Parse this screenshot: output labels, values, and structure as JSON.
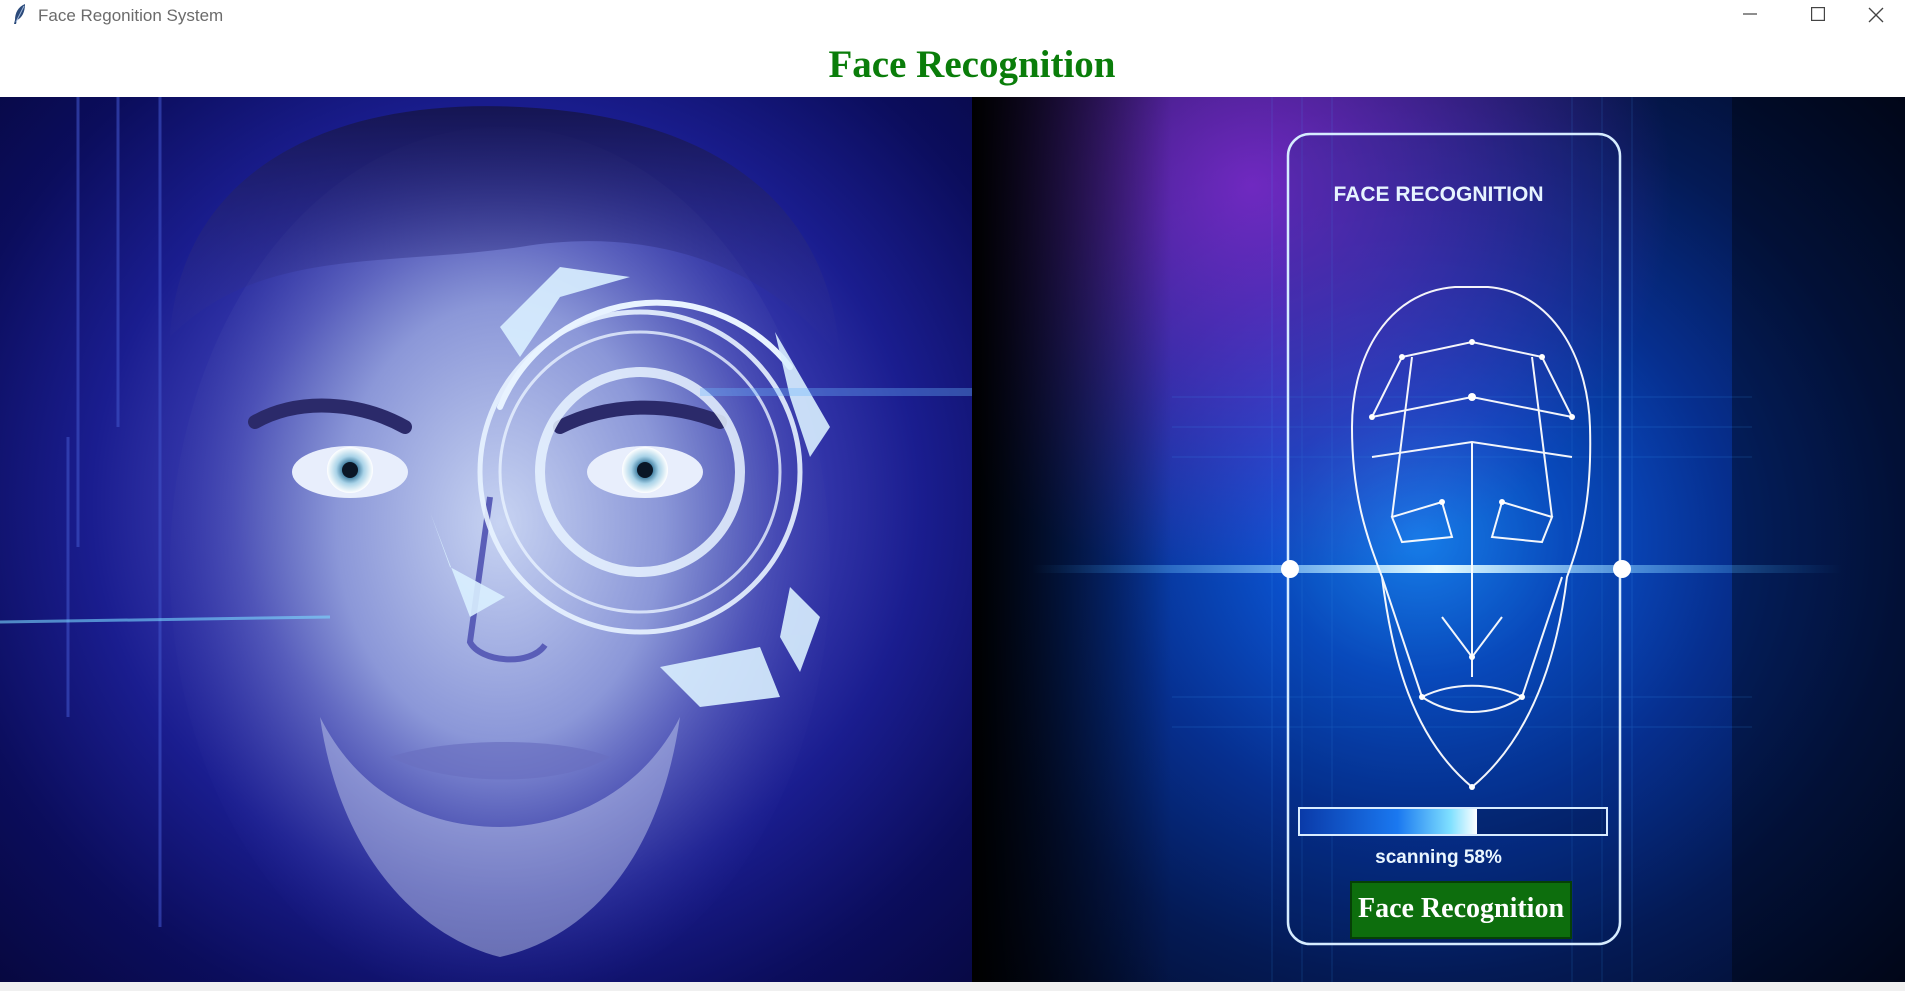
{
  "window": {
    "title": "Face Regonition System",
    "controls": [
      "minimize-icon",
      "maximize-icon",
      "close-icon"
    ]
  },
  "header": {
    "heading": "Face Recognition",
    "heading_color": "#0a7d0a"
  },
  "left_image": {
    "content": "portrait-with-eye-scan-icon"
  },
  "right_image": {
    "panel_title": "FACE RECOGNITION",
    "scan_progress": 0.58,
    "scan_text": "scanning 58%",
    "button_label": "Face Recognition",
    "button_color": "#0d6e0d"
  }
}
